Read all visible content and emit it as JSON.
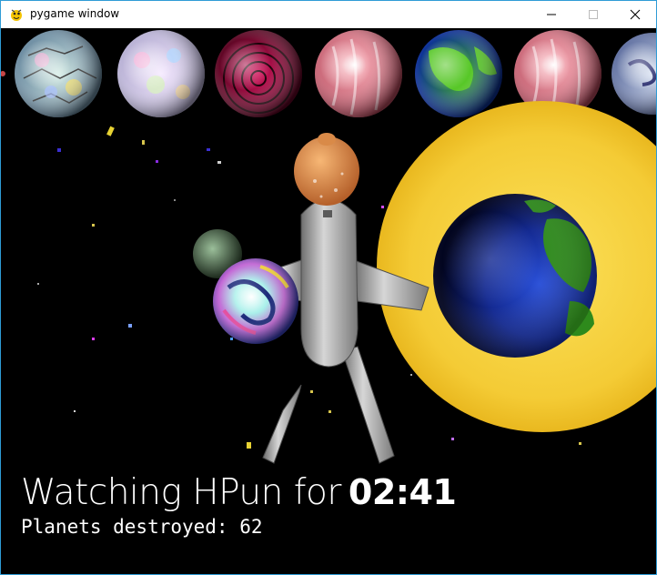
{
  "window": {
    "title": "pygame window",
    "icons": [
      "pygame-snake-icon",
      "minimize-icon",
      "maximize-icon",
      "close-icon"
    ]
  },
  "hud": {
    "watching_prefix": "Watching HPun for",
    "timer": "02:41",
    "planets_destroyed_label": "Planets destroyed: 62"
  },
  "colors": {
    "sun": "#f2c634",
    "sun_inner": "#f7d84a",
    "earth_ocean": "#1730a8",
    "earth_land": "#2f8f1d",
    "background": "#000000",
    "title_bar": "#ffffff",
    "window_border": "#2f9cd6"
  },
  "scene_objects": [
    "planet-row-top",
    "sun",
    "earth-planet",
    "rocket-robot",
    "small-moon",
    "psychedelic-planet",
    "space-debris"
  ]
}
